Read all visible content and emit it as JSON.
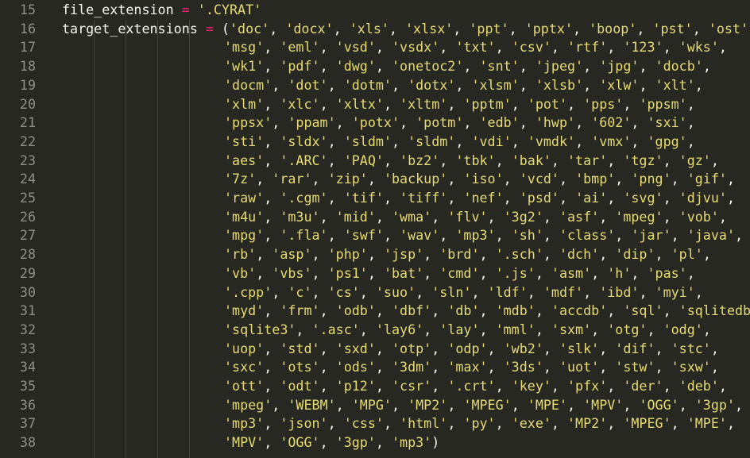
{
  "editor": {
    "lines": [
      {
        "num": "15",
        "segments": [
          {
            "t": "kw",
            "v": "file_extension"
          },
          {
            "t": "punc",
            "v": " "
          },
          {
            "t": "op",
            "v": "="
          },
          {
            "t": "punc",
            "v": " "
          },
          {
            "t": "str",
            "v": "'.CYRAT'"
          }
        ]
      },
      {
        "num": "16",
        "segments": [
          {
            "t": "kw",
            "v": "target_extensions"
          },
          {
            "t": "punc",
            "v": " "
          },
          {
            "t": "op",
            "v": "="
          },
          {
            "t": "punc",
            "v": " ("
          },
          {
            "t": "str",
            "v": "'doc'"
          },
          {
            "t": "punc",
            "v": ", "
          },
          {
            "t": "str",
            "v": "'docx'"
          },
          {
            "t": "punc",
            "v": ", "
          },
          {
            "t": "str",
            "v": "'xls'"
          },
          {
            "t": "punc",
            "v": ", "
          },
          {
            "t": "str",
            "v": "'xlsx'"
          },
          {
            "t": "punc",
            "v": ", "
          },
          {
            "t": "str",
            "v": "'ppt'"
          },
          {
            "t": "punc",
            "v": ", "
          },
          {
            "t": "str",
            "v": "'pptx'"
          },
          {
            "t": "punc",
            "v": ", "
          },
          {
            "t": "str",
            "v": "'boop'"
          },
          {
            "t": "punc",
            "v": ", "
          },
          {
            "t": "str",
            "v": "'pst'"
          },
          {
            "t": "punc",
            "v": ", "
          },
          {
            "t": "str",
            "v": "'ost'"
          },
          {
            "t": "punc",
            "v": ","
          }
        ]
      },
      {
        "num": "17",
        "cont": [
          "msg",
          "eml",
          "vsd",
          "vsdx",
          "txt",
          "csv",
          "rtf",
          "123",
          "wks"
        ]
      },
      {
        "num": "18",
        "cont": [
          "wk1",
          "pdf",
          "dwg",
          "onetoc2",
          "snt",
          "jpeg",
          "jpg",
          "docb"
        ]
      },
      {
        "num": "19",
        "cont": [
          "docm",
          "dot",
          "dotm",
          "dotx",
          "xlsm",
          "xlsb",
          "xlw",
          "xlt"
        ]
      },
      {
        "num": "20",
        "cont": [
          "xlm",
          "xlc",
          "xltx",
          "xltm",
          "pptm",
          "pot",
          "pps",
          "ppsm"
        ]
      },
      {
        "num": "21",
        "cont": [
          "ppsx",
          "ppam",
          "potx",
          "potm",
          "edb",
          "hwp",
          "602",
          "sxi"
        ]
      },
      {
        "num": "22",
        "cont": [
          "sti",
          "sldx",
          "sldm",
          "sldm",
          "vdi",
          "vmdk",
          "vmx",
          "gpg"
        ]
      },
      {
        "num": "23",
        "cont": [
          "aes",
          "ARC",
          "PAQ",
          "bz2",
          "tbk",
          "bak",
          "tar",
          "tgz",
          "gz"
        ]
      },
      {
        "num": "24",
        "cont": [
          "7z",
          "rar",
          "zip",
          "backup",
          "iso",
          "vcd",
          "bmp",
          "png",
          "gif"
        ]
      },
      {
        "num": "25",
        "cont": [
          "raw",
          "cgm",
          "tif",
          "tiff",
          "nef",
          "psd",
          "ai",
          "svg",
          "djvu"
        ]
      },
      {
        "num": "26",
        "cont": [
          "m4u",
          "m3u",
          "mid",
          "wma",
          "flv",
          "3g2",
          "asf",
          "mpeg",
          "vob"
        ]
      },
      {
        "num": "27",
        "cont": [
          "mpg",
          "fla",
          "swf",
          "wav",
          "mp3",
          "sh",
          "class",
          "jar",
          "java"
        ]
      },
      {
        "num": "28",
        "cont": [
          "rb",
          "asp",
          "php",
          "jsp",
          "brd",
          "sch",
          "dch",
          "dip",
          "pl"
        ]
      },
      {
        "num": "29",
        "cont": [
          "vb",
          "vbs",
          "ps1",
          "bat",
          "cmd",
          "js",
          "asm",
          "h",
          "pas"
        ]
      },
      {
        "num": "30",
        "cont": [
          "cpp",
          "c",
          "cs",
          "suo",
          "sln",
          "ldf",
          "mdf",
          "ibd",
          "myi"
        ]
      },
      {
        "num": "31",
        "cont": [
          "myd",
          "frm",
          "odb",
          "dbf",
          "db",
          "mdb",
          "accdb",
          "sql",
          "sqlitedb"
        ]
      },
      {
        "num": "32",
        "cont": [
          "sqlite3",
          "asc",
          "lay6",
          "lay",
          "mml",
          "sxm",
          "otg",
          "odg"
        ]
      },
      {
        "num": "33",
        "cont": [
          "uop",
          "std",
          "sxd",
          "otp",
          "odp",
          "wb2",
          "slk",
          "dif",
          "stc"
        ]
      },
      {
        "num": "34",
        "cont": [
          "sxc",
          "ots",
          "ods",
          "3dm",
          "max",
          "3ds",
          "uot",
          "stw",
          "sxw"
        ]
      },
      {
        "num": "35",
        "cont": [
          "ott",
          "odt",
          "p12",
          "csr",
          "crt",
          "key",
          "pfx",
          "der",
          "deb"
        ]
      },
      {
        "num": "36",
        "cont": [
          "mpeg",
          "WEBM",
          "MPG",
          "MP2",
          "MPEG",
          "MPE",
          "MPV",
          "OGG",
          "3gp"
        ]
      },
      {
        "num": "37",
        "cont": [
          "mp3",
          "json",
          "css",
          "html",
          "py",
          "exe",
          "MP2",
          "MPEG",
          "MPE"
        ]
      },
      {
        "num": "38",
        "cont": [
          "MPV",
          "OGG",
          "3gp",
          "mp3"
        ],
        "close": ")"
      }
    ],
    "dotted_prefixes": {
      "23": [
        1
      ],
      "25": [
        1
      ],
      "27": [
        1
      ],
      "28": [
        5
      ],
      "29": [
        5
      ],
      "30": [
        0
      ],
      "32": [
        1
      ],
      "35": [
        4
      ]
    }
  },
  "theme": {
    "background": "#272822",
    "gutter_text": "#8f908a",
    "string": "#e6db74",
    "operator": "#f92672",
    "text": "#f8f8f2",
    "indent_guide": "#464741"
  }
}
